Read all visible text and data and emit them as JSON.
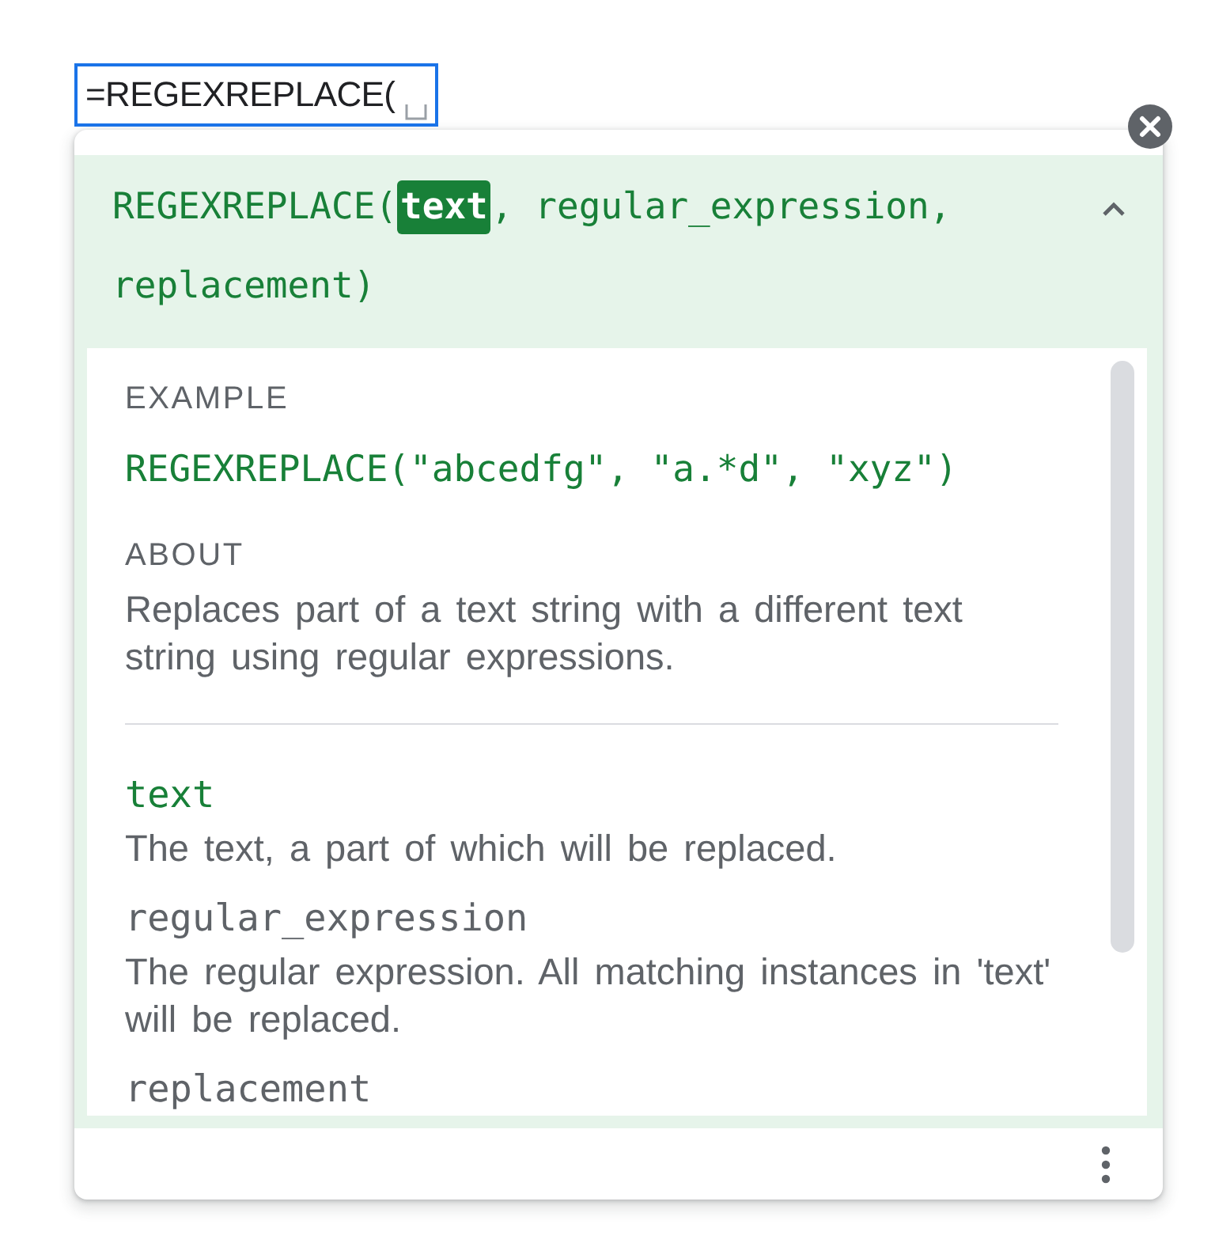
{
  "cell_editor": {
    "value": "=REGEXREPLACE("
  },
  "help_card": {
    "expanded": true,
    "signature": {
      "function": "REGEXREPLACE(",
      "arguments": [
        {
          "label": "text",
          "suffix": ",",
          "selected": true
        },
        {
          "label": "regular_expression",
          "suffix": ",",
          "selected": false
        },
        {
          "label": "replacement",
          "suffix": ")",
          "selected": false
        }
      ]
    },
    "example": {
      "heading": "EXAMPLE",
      "code": "REGEXREPLACE(\"abcedfg\", \"a.*d\", \"xyz\")"
    },
    "about": {
      "heading": "ABOUT",
      "text": "Replaces part of a text string with a different text string using regular expressions."
    },
    "arguments": [
      {
        "name": "text",
        "description": "The text, a part of which will be replaced.",
        "selected": true
      },
      {
        "name": "regular_expression",
        "description": "The regular expression. All matching instances in 'text' will be replaced.",
        "selected": false
      },
      {
        "name": "replacement",
        "selected": false
      }
    ]
  }
}
